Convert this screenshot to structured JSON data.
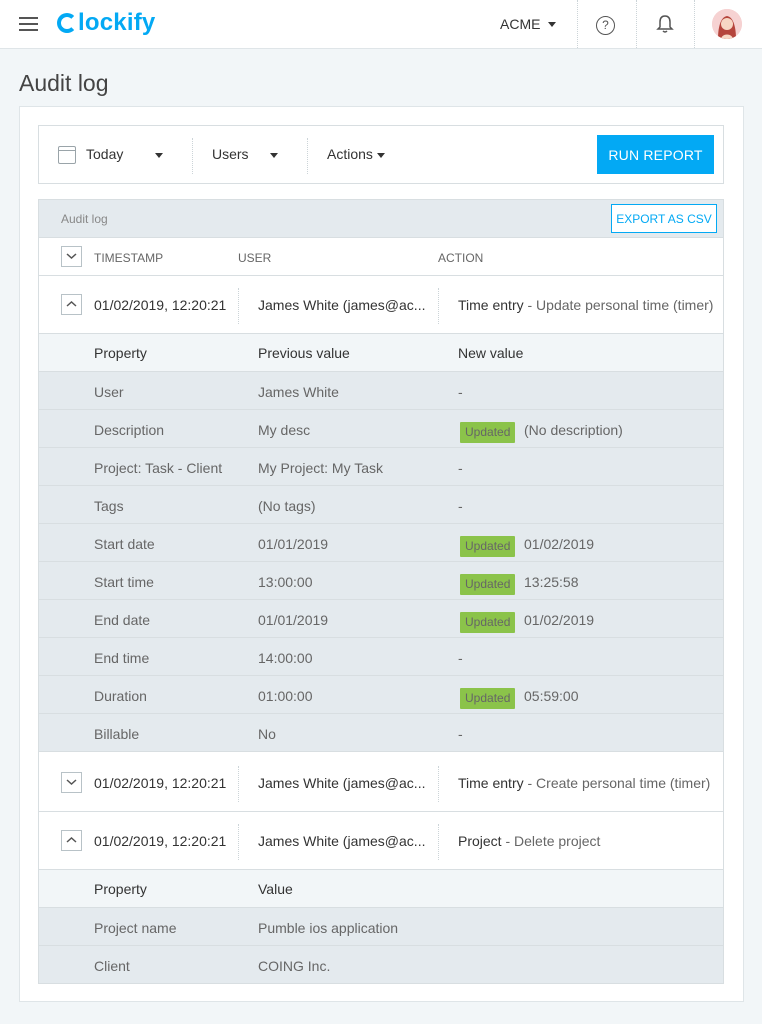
{
  "header": {
    "logo_text": "lockify",
    "workspace": "ACME",
    "help_glyph": "?",
    "icons": [
      "menu-icon",
      "help-icon",
      "bell-icon",
      "avatar"
    ]
  },
  "page": {
    "title": "Audit log"
  },
  "filters": {
    "date": "Today",
    "users": "Users",
    "actions": "Actions",
    "run_button": "RUN REPORT"
  },
  "report": {
    "title": "Audit log",
    "export_button": "EXPORT AS CSV",
    "columns": [
      "TIMESTAMP",
      "USER",
      "ACTION"
    ]
  },
  "entries": [
    {
      "timestamp": "01/02/2019, 12:20:21",
      "user": "James White (james@ac...",
      "action_type": "Time entry",
      "action_detail": "- Update personal time (timer)",
      "expanded": true,
      "detail_headers": [
        "Property",
        "Previous value",
        "New value"
      ],
      "properties": [
        {
          "property": "User",
          "previous": "James White",
          "new": "-",
          "updated": false
        },
        {
          "property": "Description",
          "previous": "My desc",
          "new": "(No description)",
          "updated": true
        },
        {
          "property": "Project: Task - Client",
          "previous": "My Project: My Task",
          "new": "-",
          "updated": false
        },
        {
          "property": "Tags",
          "previous": "(No tags)",
          "new": "-",
          "updated": false
        },
        {
          "property": "Start date",
          "previous": "01/01/2019",
          "new": "01/02/2019",
          "updated": true
        },
        {
          "property": "Start time",
          "previous": "13:00:00",
          "new": "13:25:58",
          "updated": true
        },
        {
          "property": "End date",
          "previous": "01/01/2019",
          "new": "01/02/2019",
          "updated": true
        },
        {
          "property": "End time",
          "previous": "14:00:00",
          "new": "-",
          "updated": false
        },
        {
          "property": "Duration",
          "previous": "01:00:00",
          "new": "05:59:00",
          "updated": true
        },
        {
          "property": "Billable",
          "previous": "No",
          "new": "-",
          "updated": false
        }
      ]
    },
    {
      "timestamp": "01/02/2019, 12:20:21",
      "user": "James White (james@ac...",
      "action_type": "Time entry",
      "action_detail": "- Create personal time (timer)",
      "expanded": false
    },
    {
      "timestamp": "01/02/2019, 12:20:21",
      "user": "James White (james@ac...",
      "action_type": "Project",
      "action_detail": "- Delete project",
      "expanded": true,
      "detail_headers": [
        "Property",
        "Value"
      ],
      "properties": [
        {
          "property": "Project name",
          "previous": "Pumble ios application"
        },
        {
          "property": "Client",
          "previous": "COING Inc."
        }
      ]
    }
  ],
  "badge_label": "Updated",
  "colors": {
    "accent": "#03a9f4",
    "updated_badge": "#8bc34a",
    "row_bg": "#e4eaee"
  }
}
